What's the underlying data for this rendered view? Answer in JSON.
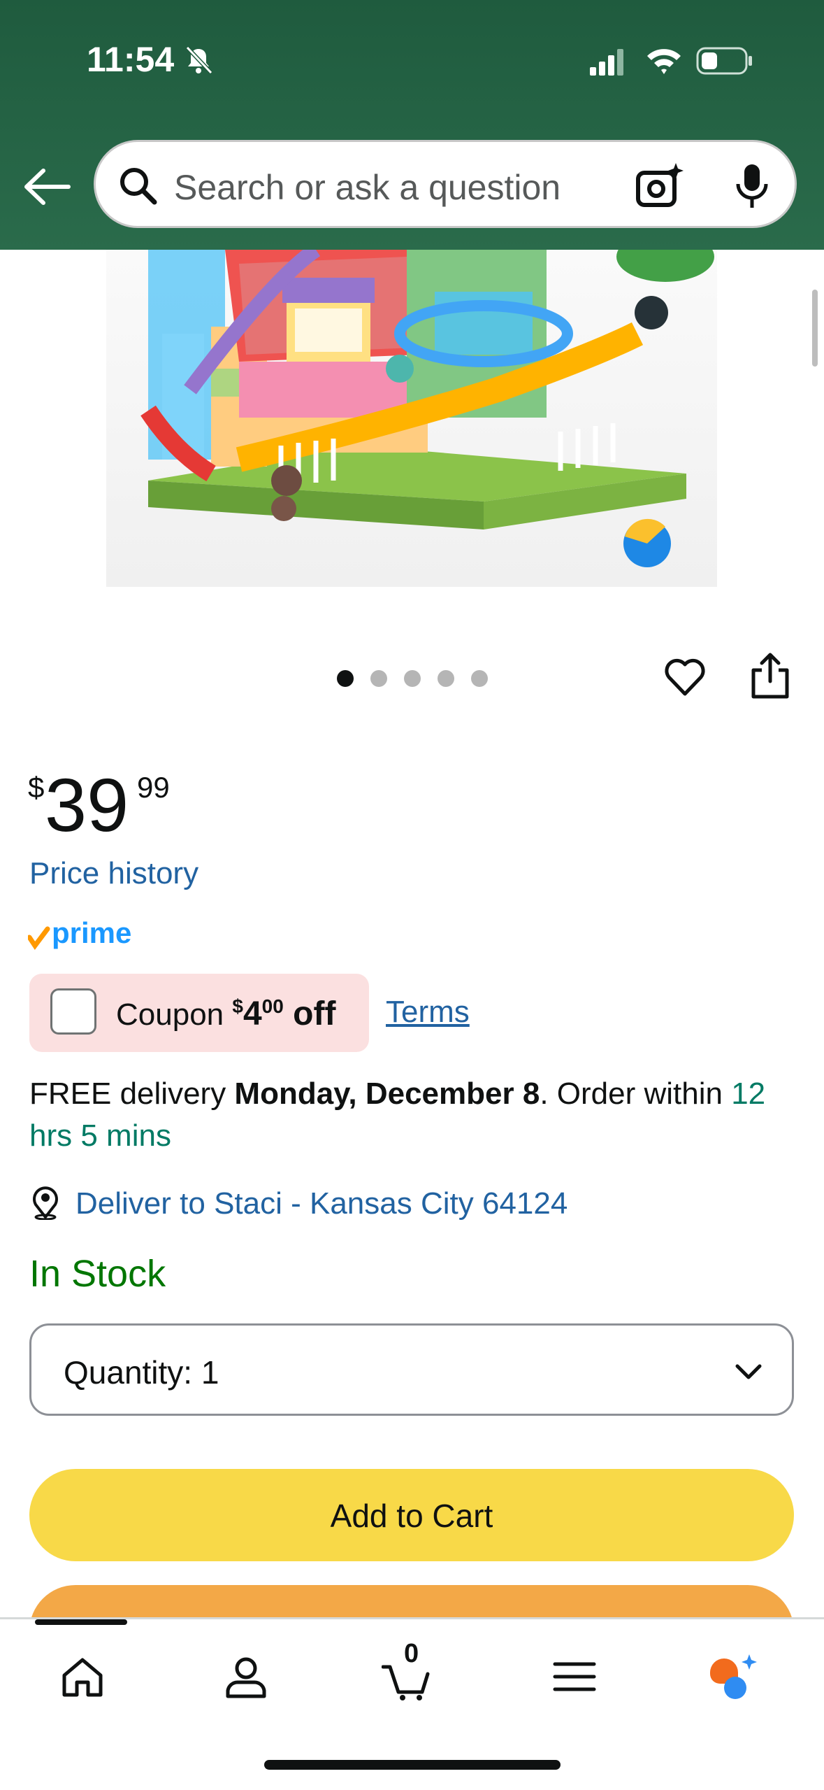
{
  "status_bar": {
    "time": "11:54"
  },
  "search": {
    "placeholder": "Search or ask a question"
  },
  "product": {
    "image_alt": "Marble run building block house toy set",
    "carousel_count": 5,
    "carousel_active": 0
  },
  "price": {
    "symbol": "$",
    "whole": "39",
    "fraction": "99"
  },
  "price_history_label": "Price history",
  "prime_label": "prime",
  "coupon": {
    "prefix": "Coupon",
    "symbol": "$",
    "whole": "4",
    "fraction": "00",
    "suffix": "off",
    "terms_label": "Terms"
  },
  "delivery": {
    "free": "FREE delivery ",
    "date": "Monday, December 8",
    "order_within": ". Order within ",
    "countdown": "12 hrs 5 mins"
  },
  "deliver_to": "Deliver to Staci - Kansas City 64124",
  "stock_status": "In Stock",
  "quantity": {
    "label": "Quantity:",
    "value": "1"
  },
  "buttons": {
    "add_to_cart": "Add to Cart"
  },
  "bottom_nav": {
    "cart_count": "0"
  },
  "colors": {
    "header": "#1f5b3e",
    "add_to_cart": "#f8d948",
    "buy_now": "#f3a847",
    "link": "#2162a1",
    "stock": "#007600"
  }
}
